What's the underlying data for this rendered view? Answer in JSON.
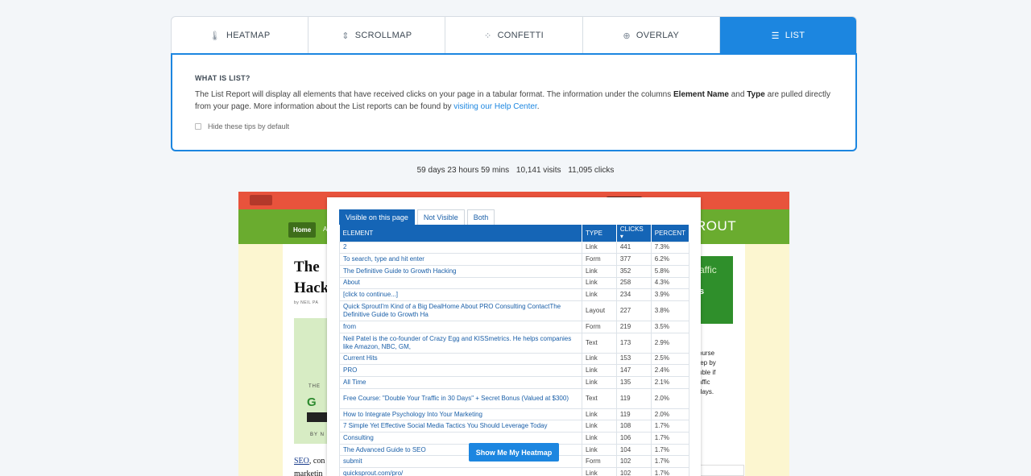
{
  "tabs": [
    {
      "label": "HEATMAP",
      "icon": "thermometer-icon",
      "glyph": "🌡"
    },
    {
      "label": "SCROLLMAP",
      "icon": "scroll-icon",
      "glyph": "⇕"
    },
    {
      "label": "CONFETTI",
      "icon": "confetti-icon",
      "glyph": "⁘"
    },
    {
      "label": "OVERLAY",
      "icon": "plus-circle-icon",
      "glyph": "⊕"
    },
    {
      "label": "LIST",
      "icon": "list-icon",
      "glyph": "☰"
    }
  ],
  "info": {
    "heading": "WHAT IS LIST?",
    "text1": "The List Report will display all elements that have received clicks on your page in a tabular format. The information under the columns ",
    "bold1": "Element Name",
    "text2": " and ",
    "bold2": "Type",
    "text3": " are pulled directly from your page. More information about the List reports can be found by ",
    "link": "visiting our Help Center",
    "text4": ".",
    "tips_label": "Hide these tips by default"
  },
  "stats": {
    "duration": "59 days 23 hours 59 mins",
    "visits": "10,141 visits",
    "clicks": "11,095 clicks"
  },
  "preview": {
    "home": "Home",
    "nav_a": "A",
    "brand_tail": "ROUT",
    "title_1": "The",
    "title_2": "Hack",
    "byline": "by NEIL PA",
    "book_the": "THE",
    "book_g": "G",
    "book_by": "BY N",
    "seo_link": "SEO",
    "seo_rest": ", con",
    "marketing": "marketin",
    "ad_1": "affic",
    "ad_2": "s",
    "side_1": "ourse",
    "side_2": "tep by",
    "side_3": "uble if",
    "side_4": "affic",
    "side_5": "days."
  },
  "list": {
    "subtabs": [
      "Visible on this page",
      "Not Visible",
      "Both"
    ],
    "columns": [
      "ELEMENT",
      "TYPE",
      "CLICKS",
      "PERCENT"
    ],
    "rows": [
      {
        "element": "2",
        "type": "Link",
        "clicks": "441",
        "percent": "7.3%"
      },
      {
        "element": "To search, type and hit enter",
        "type": "Form",
        "clicks": "377",
        "percent": "6.2%"
      },
      {
        "element": "The Definitive Guide to Growth Hacking",
        "type": "Link",
        "clicks": "352",
        "percent": "5.8%"
      },
      {
        "element": "About",
        "type": "Link",
        "clicks": "258",
        "percent": "4.3%"
      },
      {
        "element": "[click to continue...]",
        "type": "Link",
        "clicks": "234",
        "percent": "3.9%"
      },
      {
        "element": "Quick SproutI'm Kind of a Big DealHome About PRO Consulting ContactThe Definitive Guide to Growth Ha",
        "type": "Layout",
        "clicks": "227",
        "percent": "3.8%"
      },
      {
        "element": "from",
        "type": "Form",
        "clicks": "219",
        "percent": "3.5%"
      },
      {
        "element": "Neil Patel is the co-founder of Crazy Egg and KISSmetrics. He helps companies like Amazon, NBC, GM,",
        "type": "Text",
        "clicks": "173",
        "percent": "2.9%"
      },
      {
        "element": "Current Hits",
        "type": "Link",
        "clicks": "153",
        "percent": "2.5%"
      },
      {
        "element": "PRO",
        "type": "Link",
        "clicks": "147",
        "percent": "2.4%"
      },
      {
        "element": "All Time",
        "type": "Link",
        "clicks": "135",
        "percent": "2.1%"
      },
      {
        "element": "Free Course: \"Double Your Traffic in 30 Days\" + Secret Bonus (Valued at $300)",
        "type": "Text",
        "clicks": "119",
        "percent": "2.0%"
      },
      {
        "element": "How to Integrate Psychology Into Your Marketing",
        "type": "Link",
        "clicks": "119",
        "percent": "2.0%"
      },
      {
        "element": "7 Simple Yet Effective Social Media Tactics You Should Leverage Today",
        "type": "Link",
        "clicks": "108",
        "percent": "1.7%"
      },
      {
        "element": "Consulting",
        "type": "Link",
        "clicks": "106",
        "percent": "1.7%"
      },
      {
        "element": "The Advanced Guide to SEO",
        "type": "Link",
        "clicks": "104",
        "percent": "1.7%"
      },
      {
        "element": "submit",
        "type": "Form",
        "clicks": "102",
        "percent": "1.7%"
      },
      {
        "element": "quicksprout.com/pro/",
        "type": "Link",
        "clicks": "102",
        "percent": "1.7%"
      }
    ],
    "button": "Show Me My Heatmap"
  }
}
